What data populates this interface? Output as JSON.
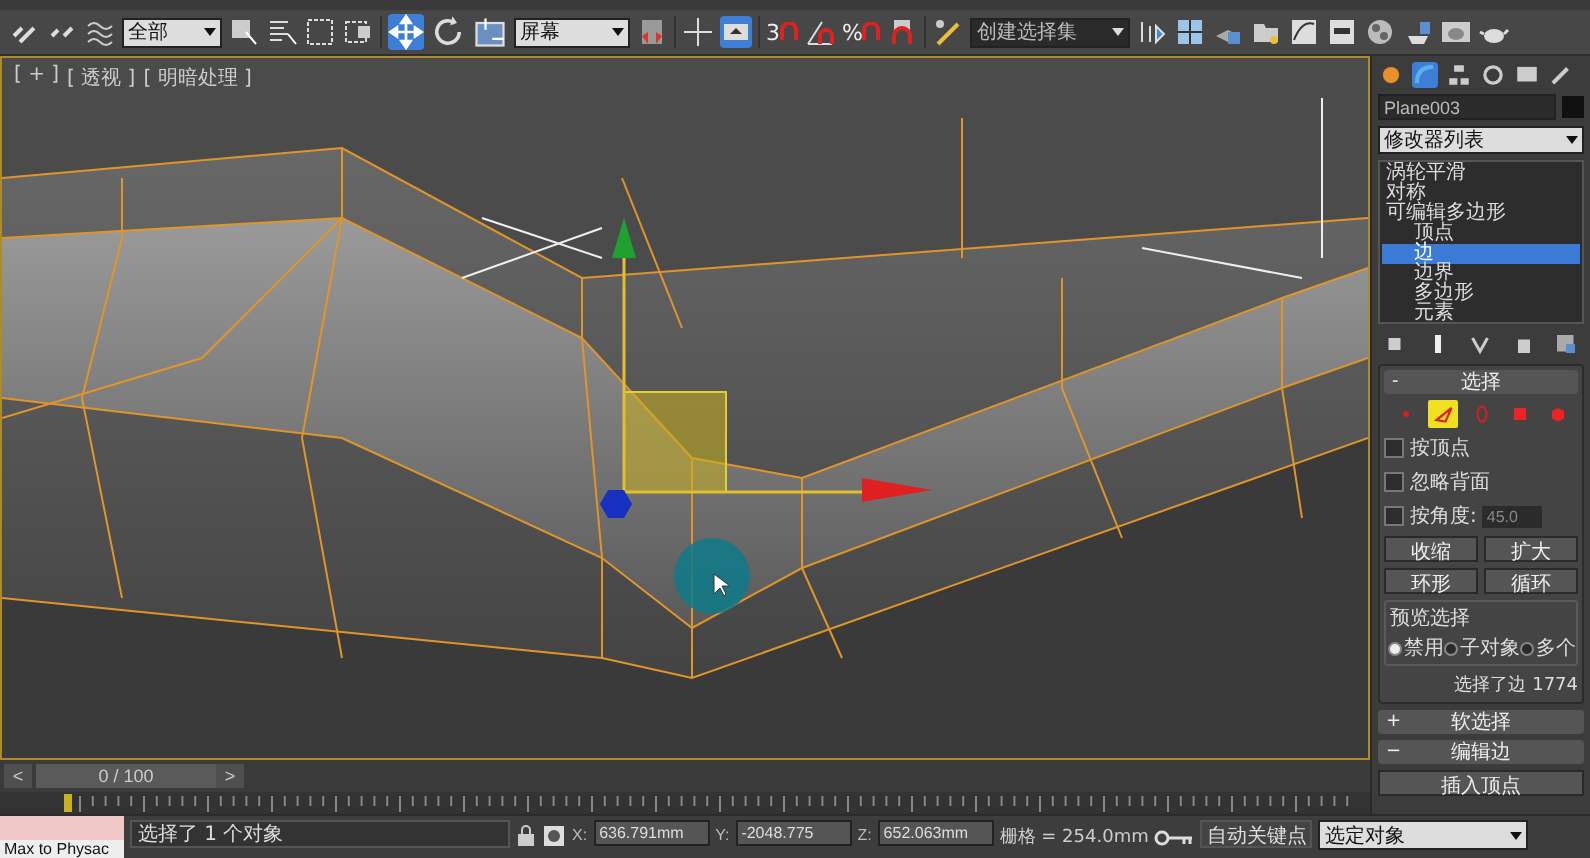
{
  "toolbar": {
    "selection_filter": "全部",
    "transform_tools": [
      {
        "kind": "move",
        "selected": true
      },
      {
        "kind": "rotate",
        "selected": false
      },
      {
        "kind": "scale",
        "selected": false
      }
    ],
    "reference_coord": "屏幕",
    "snap_dimension": "3",
    "percent_symbol": "%",
    "named_selection_set": "创建选择集"
  },
  "viewport": {
    "labels": [
      "[ + ]",
      "[ 透视 ]",
      "[ 明暗处理 ]"
    ]
  },
  "command_panel": {
    "object_name": "Plane003",
    "modifier_list": "修改器列表",
    "stack": [
      {
        "name": "涡轮平滑",
        "selected": false
      },
      {
        "name": "对称",
        "selected": false
      },
      {
        "name": "可编辑多边形",
        "selected": false,
        "children": [
          {
            "name": "顶点",
            "selected": false
          },
          {
            "name": "边",
            "selected": true
          },
          {
            "name": "边界",
            "selected": false
          },
          {
            "name": "多边形",
            "selected": false
          },
          {
            "name": "元素",
            "selected": false
          }
        ]
      }
    ],
    "selection_rollout": {
      "title": "选择",
      "symbol": "-",
      "subobject_levels": [
        {
          "kind": "vertex",
          "selected": false
        },
        {
          "kind": "edge",
          "selected": true
        },
        {
          "kind": "border",
          "selected": false
        },
        {
          "kind": "polygon",
          "selected": false
        },
        {
          "kind": "element",
          "selected": false
        }
      ],
      "checkboxes": [
        {
          "label": "按顶点",
          "checked": false
        },
        {
          "label": "忽略背面",
          "checked": false
        },
        {
          "label": "按角度:",
          "checked": false
        }
      ],
      "angle_value": "45.0",
      "buttons": [
        "收缩",
        "扩大"
      ],
      "spinner_buttons": [
        "环形",
        "循环"
      ],
      "preview_title": "预览选择",
      "preview_options": [
        {
          "label": "禁用",
          "selected": true
        },
        {
          "label": "子对象",
          "selected": false
        },
        {
          "label": "多个",
          "selected": false
        }
      ],
      "info": "选择了边 1774"
    },
    "rollouts": [
      {
        "title": "软选择",
        "symbol": "+"
      },
      {
        "title": "编辑边",
        "symbol": "−"
      }
    ],
    "edit_edges_button": "插入顶点"
  },
  "timeline": {
    "prev": "<",
    "position": "0 / 100",
    "next": ">"
  },
  "status_bar": {
    "script_label": "Max to Physac",
    "prompt": "选择了 1 个对象",
    "coords": [
      {
        "axis": "X:",
        "value": "636.791mm"
      },
      {
        "axis": "Y:",
        "value": "-2048.775"
      },
      {
        "axis": "Z:",
        "value": "652.063mm"
      }
    ],
    "grid": "栅格 = 254.0mm",
    "auto_key": "自动关键点",
    "key_filter": "选定对象"
  }
}
